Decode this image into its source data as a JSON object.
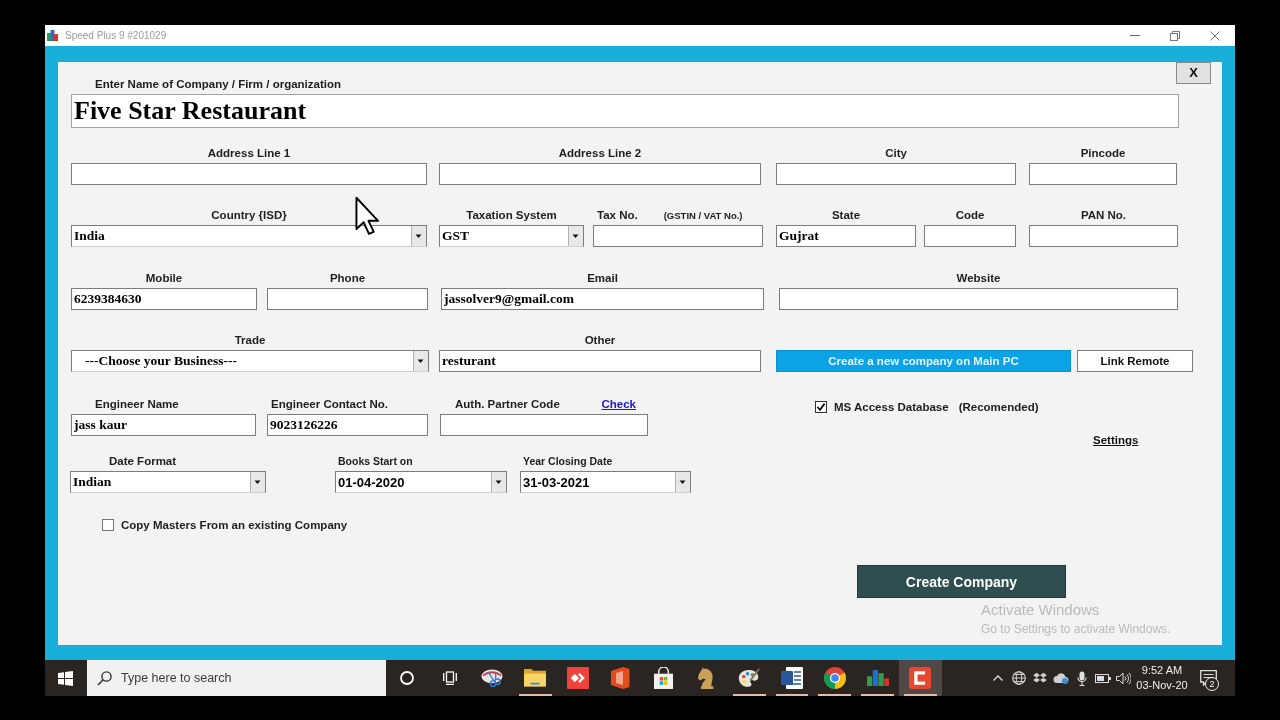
{
  "window": {
    "title": "Speed Plus 9 #201029"
  },
  "form": {
    "close_button": "X",
    "company": {
      "label": "Enter Name of Company / Firm / organization",
      "value": "Five Star Restaurant"
    },
    "rows": [
      {
        "fields": [
          {
            "kind": "text",
            "label": "Address Line 1"
          },
          {
            "kind": "text",
            "label": "Address Line 2"
          },
          {
            "kind": "text",
            "label": "City"
          },
          {
            "kind": "text",
            "label": "Pincode"
          }
        ]
      },
      {
        "fields": [
          {
            "kind": "select",
            "label": "Country {ISD}",
            "value": "India"
          },
          {
            "kind": "select",
            "label": "Taxation System",
            "value": "GST"
          },
          {
            "kind": "text",
            "label": "Tax No.",
            "note": "(GSTIN / VAT No.)"
          },
          {
            "kind": "text",
            "label": "State",
            "value": "Gujrat"
          },
          {
            "kind": "text",
            "label": "Code"
          },
          {
            "kind": "text",
            "label": "PAN No."
          }
        ]
      },
      {
        "fields": [
          {
            "kind": "text",
            "label": "Mobile",
            "value": "6239384630"
          },
          {
            "kind": "text",
            "label": "Phone"
          },
          {
            "kind": "text",
            "label": "Email",
            "value": "jassolver9@gmail.com"
          },
          {
            "kind": "text",
            "label": "Website"
          }
        ]
      },
      {
        "fields": [
          {
            "kind": "select",
            "label": "Trade",
            "value": "---Choose your Business---"
          },
          {
            "kind": "text",
            "label": "Other",
            "value": "resturant"
          }
        ],
        "buttons": [
          {
            "kind": "primary",
            "label": "Create a new company on Main PC"
          },
          {
            "kind": "plain",
            "label": "Link Remote"
          }
        ]
      },
      {
        "fields": [
          {
            "kind": "text",
            "label": "Engineer Name",
            "value": "jass kaur"
          },
          {
            "kind": "text",
            "label": "Engineer Contact No.",
            "value": "9023126226"
          },
          {
            "kind": "text",
            "label": "Auth. Partner Code",
            "link": "Check"
          }
        ],
        "checkbox": {
          "label": "MS Access Database",
          "note": "(Recomended)",
          "checked": true
        },
        "link": "Settings"
      },
      {
        "fields": [
          {
            "kind": "select",
            "label": "Date Format",
            "value": "Indian"
          },
          {
            "kind": "select",
            "label": "Books Start on",
            "value": "01-04-2020"
          },
          {
            "kind": "select",
            "label": "Year Closing Date",
            "value": "31-03-2021"
          }
        ]
      }
    ],
    "copy_masters": {
      "label": "Copy Masters From an existing Company",
      "checked": false
    },
    "create_button": "Create Company"
  },
  "activation_notice": {
    "title": "Activate Windows",
    "text": "Go to Settings to activate Windows."
  },
  "taskbar": {
    "search": {
      "placeholder": "Type here to search"
    },
    "apps": [
      {
        "kind": "scissors",
        "running": false,
        "selected": false
      },
      {
        "kind": "folder",
        "running": true,
        "selected": false
      },
      {
        "kind": "arrows",
        "running": false,
        "selected": false
      },
      {
        "kind": "door",
        "running": false,
        "selected": false
      },
      {
        "kind": "bag",
        "running": false,
        "selected": false
      },
      {
        "kind": "knight",
        "running": false,
        "selected": false
      },
      {
        "kind": "palette",
        "running": true,
        "selected": false
      },
      {
        "kind": "document",
        "running": true,
        "selected": false
      },
      {
        "kind": "wheel",
        "running": true,
        "selected": false
      },
      {
        "kind": "bars",
        "running": true,
        "selected": false
      },
      {
        "kind": "bracket",
        "running": true,
        "selected": true
      }
    ],
    "clock": {
      "time": "9:52 AM",
      "date": "03-Nov-20"
    },
    "notifications": {
      "count": "2"
    }
  }
}
